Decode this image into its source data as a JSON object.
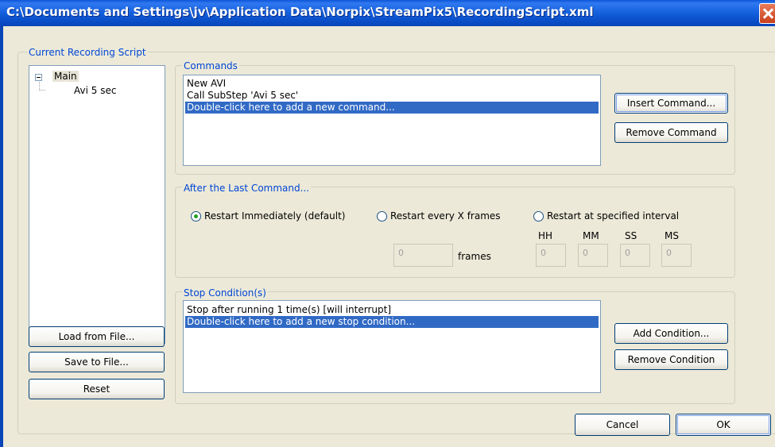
{
  "window": {
    "title": "C:\\Documents and Settings\\jv\\Application Data\\Norpix\\StreamPix5\\RecordingScript.xml"
  },
  "current_script": {
    "label": "Current Recording Script",
    "tree": {
      "root": "Main",
      "children": [
        "Avi 5 sec"
      ]
    },
    "buttons": {
      "load": "Load from File...",
      "save": "Save  to File...",
      "reset": "Reset"
    }
  },
  "commands": {
    "label": "Commands",
    "items": [
      "New AVI",
      "Call SubStep 'Avi 5 sec'",
      "Double-click here to add a new command..."
    ],
    "selected_index": 2,
    "insert_button": "Insert Command...",
    "remove_button": "Remove Command"
  },
  "after_last": {
    "label": "After the Last Command...",
    "options": [
      "Restart Immediately (default)",
      "Restart every X frames",
      "Restart at specified interval"
    ],
    "selected_index": 0,
    "frames_value": "0",
    "frames_label": "frames",
    "time_headers": [
      "HH",
      "MM",
      "SS",
      "MS"
    ],
    "time_values": [
      "0",
      "0",
      "0",
      "0"
    ]
  },
  "stop": {
    "label": "Stop Condition(s)",
    "items": [
      "Stop after running 1 time(s) [will interrupt]",
      "Double-click here to add a new stop condition..."
    ],
    "selected_index": 1,
    "add_button": "Add Condition...",
    "remove_button": "Remove Condition"
  },
  "footer": {
    "cancel": "Cancel",
    "ok": "OK"
  },
  "colors": {
    "accent_label": "#0046d5",
    "selection": "#316ac5",
    "dialog_bg": "#ece9d8"
  }
}
